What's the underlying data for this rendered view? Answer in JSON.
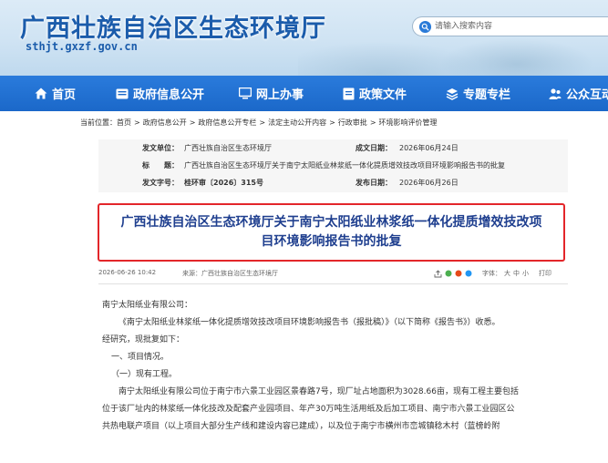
{
  "header": {
    "site_title": "广西壮族自治区生态环境厅",
    "site_domain": "sthjt.gxzf.gov.cn",
    "search": {
      "placeholder": "请输入搜索内容"
    }
  },
  "nav": {
    "items": [
      {
        "label": "首页",
        "icon": "home-icon"
      },
      {
        "label": "政府信息公开",
        "icon": "info-icon"
      },
      {
        "label": "网上办事",
        "icon": "monitor-icon"
      },
      {
        "label": "政策文件",
        "icon": "document-icon"
      },
      {
        "label": "专题专栏",
        "icon": "layers-icon"
      },
      {
        "label": "公众互动",
        "icon": "people-icon"
      }
    ]
  },
  "breadcrumb": {
    "prefix": "当前位置：",
    "items": [
      "首页",
      "政府信息公开",
      "政府信息公开专栏",
      "法定主动公开内容",
      "行政审批",
      "环境影响评价管理"
    ]
  },
  "meta": {
    "issuer_label": "发文单位：",
    "issuer": "广西壮族自治区生态环境厅",
    "created_label": "成文日期：",
    "created": "2026年06月24日",
    "title_label": "标　　题：",
    "title": "广西壮族自治区生态环境厅关于南宁太阳纸业林浆纸一体化提质增效技改项目环境影响报告书的批复",
    "docno_label": "发文字号：",
    "docno": "桂环审〔2026〕315号",
    "published_label": "发布日期：",
    "published": "2026年06月26日"
  },
  "article": {
    "title": "广西壮族自治区生态环境厅关于南宁太阳纸业林浆纸一体化提质增效技改项目环境影响报告书的批复",
    "datetime": "2026-06-26 10:42",
    "source_label": "来源：",
    "source": "广西壮族自治区生态环境厅",
    "font_label": "字体：",
    "font_large": "大",
    "font_medium": "中",
    "font_small": "小",
    "print": "打印",
    "paragraphs": [
      "南宁太阳纸业有限公司：",
      "《南宁太阳纸业林浆纸一体化提质增效技改项目环境影响报告书（报批稿）》（以下简称《报告书》）收悉。",
      "经研究，现批复如下：",
      "一、项目情况。",
      "（一）现有工程。",
      "南宁太阳纸业有限公司位于南宁市六景工业园区景春路7号，现厂址占地面积为3028.66亩，现有工程主要包括",
      "位于该厂址内的林浆纸一体化技改及配套产业园项目、年产30万吨生活用纸及后加工项目、南宁市六景工业园区公",
      "共热电联产项目（以上项目大部分生产线和建设内容已建成），以及位于南宁市横州市峦城镇稔木村（蓝榜岭附"
    ]
  }
}
